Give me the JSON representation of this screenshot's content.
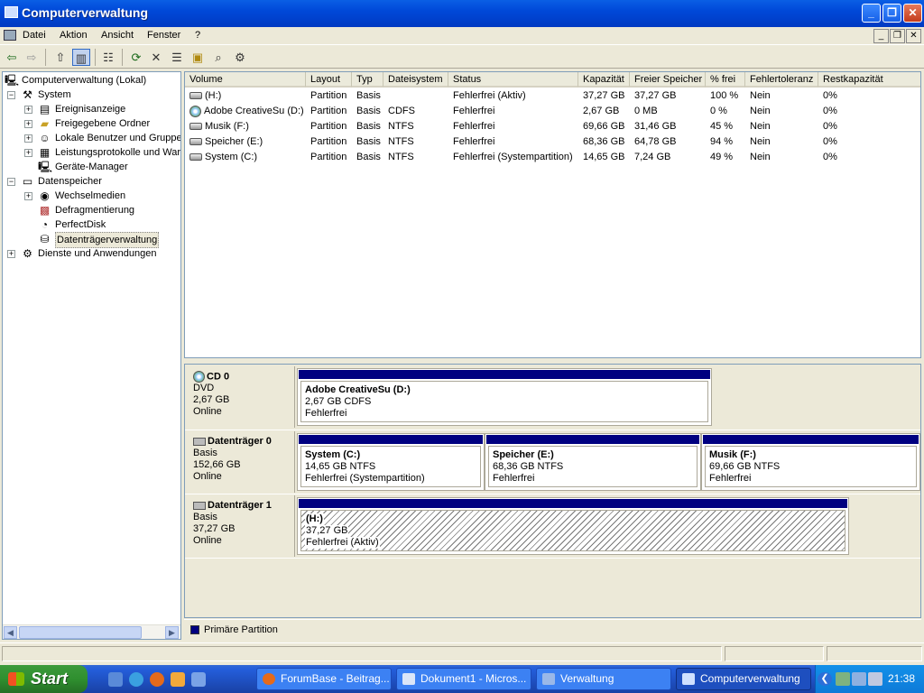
{
  "window": {
    "title": "Computerverwaltung"
  },
  "menu": {
    "items": [
      "Datei",
      "Aktion",
      "Ansicht",
      "Fenster",
      "?"
    ]
  },
  "mdi_buttons": [
    "_",
    "❐",
    "✕"
  ],
  "toolbar": {
    "icons": [
      "back-icon",
      "forward-icon",
      "up-folder-icon",
      "show-tree-icon",
      "properties-icon",
      "refresh-icon",
      "delete-icon",
      "properties2-icon",
      "open-icon",
      "search-icon",
      "settings-icon"
    ]
  },
  "tree": {
    "root": "Computerverwaltung (Lokal)",
    "system": "System",
    "system_items": [
      "Ereignisanzeige",
      "Freigegebene Ordner",
      "Lokale Benutzer und Gruppen",
      "Leistungsprotokolle und Warnungen",
      "Geräte-Manager"
    ],
    "storage": "Datenspeicher",
    "storage_items": [
      "Wechselmedien",
      "Defragmentierung",
      "PerfectDisk",
      "Datenträgerverwaltung"
    ],
    "services": "Dienste und Anwendungen"
  },
  "volumes": {
    "columns": [
      "Volume",
      "Layout",
      "Typ",
      "Dateisystem",
      "Status",
      "Kapazität",
      "Freier Speicher",
      "% frei",
      "Fehlertoleranz",
      "Restkapazität"
    ],
    "rows": [
      {
        "icon": "disk",
        "cells": [
          "(H:)",
          "Partition",
          "Basis",
          "",
          "Fehlerfrei (Aktiv)",
          "37,27 GB",
          "37,27 GB",
          "100 %",
          "Nein",
          "0%"
        ]
      },
      {
        "icon": "cd",
        "cells": [
          "Adobe CreativeSu (D:)",
          "Partition",
          "Basis",
          "CDFS",
          "Fehlerfrei",
          "2,67 GB",
          "0 MB",
          "0 %",
          "Nein",
          "0%"
        ]
      },
      {
        "icon": "disk",
        "cells": [
          "Musik (F:)",
          "Partition",
          "Basis",
          "NTFS",
          "Fehlerfrei",
          "69,66 GB",
          "31,46 GB",
          "45 %",
          "Nein",
          "0%"
        ]
      },
      {
        "icon": "disk",
        "cells": [
          "Speicher (E:)",
          "Partition",
          "Basis",
          "NTFS",
          "Fehlerfrei",
          "68,36 GB",
          "64,78 GB",
          "94 %",
          "Nein",
          "0%"
        ]
      },
      {
        "icon": "disk",
        "cells": [
          "System (C:)",
          "Partition",
          "Basis",
          "NTFS",
          "Fehlerfrei (Systempartition)",
          "14,65 GB",
          "7,24 GB",
          "49 %",
          "Nein",
          "0%"
        ]
      }
    ]
  },
  "disks": [
    {
      "name": "CD 0",
      "type": "DVD",
      "size": "2,67 GB",
      "state": "Online",
      "partitions": [
        {
          "name": "Adobe CreativeSu  (D:)",
          "size": "2,67 GB CDFS",
          "status": "Fehlerfrei"
        }
      ]
    },
    {
      "name": "Datenträger 0",
      "type": "Basis",
      "size": "152,66 GB",
      "state": "Online",
      "partitions": [
        {
          "name": "System  (C:)",
          "size": "14,65 GB NTFS",
          "status": "Fehlerfrei (Systempartition)"
        },
        {
          "name": "Speicher  (E:)",
          "size": "68,36 GB NTFS",
          "status": "Fehlerfrei"
        },
        {
          "name": "Musik  (F:)",
          "size": "69,66 GB NTFS",
          "status": "Fehlerfrei"
        }
      ]
    },
    {
      "name": "Datenträger 1",
      "type": "Basis",
      "size": "37,27 GB",
      "state": "Online",
      "partitions": [
        {
          "name": "(H:)",
          "size": "37,27 GB",
          "status": "Fehlerfrei (Aktiv)"
        }
      ]
    }
  ],
  "legend": {
    "label": "Primäre Partition",
    "color": "#000080"
  },
  "taskbar": {
    "start": "Start",
    "tasks": [
      "ForumBase - Beitrag...",
      "Dokument1 - Micros...",
      "Verwaltung",
      "Computerverwaltung"
    ],
    "clock": "21:38"
  }
}
